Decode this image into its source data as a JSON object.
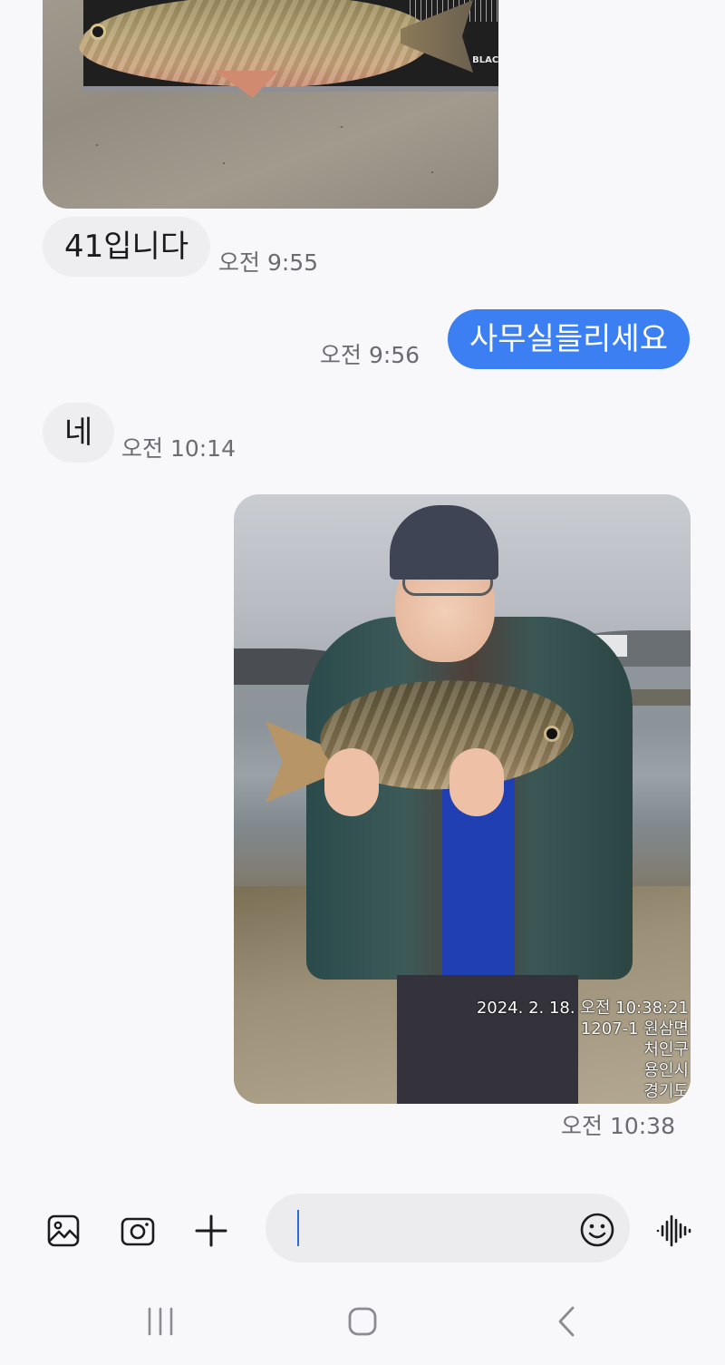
{
  "messages": [
    {
      "type": "image",
      "direction": "incoming",
      "description_icon": "fish-on-ruler-photo"
    },
    {
      "type": "text",
      "direction": "incoming",
      "text": "41입니다",
      "time": "오전 9:55"
    },
    {
      "type": "text",
      "direction": "outgoing",
      "text": "사무실들리세요",
      "time": "오전 9:56"
    },
    {
      "type": "text",
      "direction": "incoming",
      "text": "네",
      "time": "오전 10:14"
    },
    {
      "type": "image",
      "direction": "outgoing",
      "time": "오전 10:38",
      "overlay": [
        "2024. 2. 18. 오전 10:38:21",
        "1207-1 원삼면",
        "처인구",
        "용인시",
        "경기도"
      ]
    }
  ],
  "ruler_brand": "BLACK",
  "composer": {
    "placeholder": "",
    "value": "",
    "tools": [
      "gallery-icon",
      "camera-icon",
      "plus-icon"
    ],
    "emoji_icon": "smiley-icon",
    "voice_icon": "voice-wave-icon"
  },
  "navbar": {
    "buttons": [
      "recent-apps-icon",
      "home-icon",
      "back-icon"
    ]
  },
  "colors": {
    "accent": "#3b7ff2",
    "incoming_bubble": "#eeeef1",
    "background": "#f8f8fb"
  }
}
